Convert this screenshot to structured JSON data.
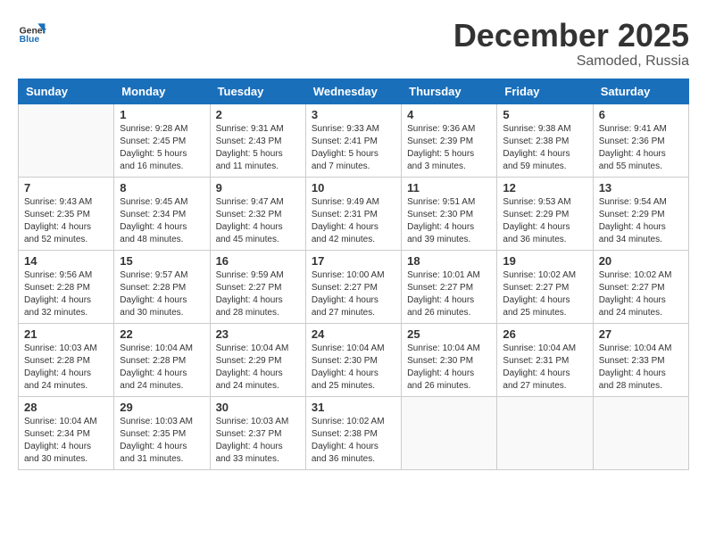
{
  "header": {
    "logo_line1": "General",
    "logo_line2": "Blue",
    "month": "December 2025",
    "location": "Samoded, Russia"
  },
  "weekdays": [
    "Sunday",
    "Monday",
    "Tuesday",
    "Wednesday",
    "Thursday",
    "Friday",
    "Saturday"
  ],
  "weeks": [
    [
      {
        "day": "",
        "info": ""
      },
      {
        "day": "1",
        "info": "Sunrise: 9:28 AM\nSunset: 2:45 PM\nDaylight: 5 hours\nand 16 minutes."
      },
      {
        "day": "2",
        "info": "Sunrise: 9:31 AM\nSunset: 2:43 PM\nDaylight: 5 hours\nand 11 minutes."
      },
      {
        "day": "3",
        "info": "Sunrise: 9:33 AM\nSunset: 2:41 PM\nDaylight: 5 hours\nand 7 minutes."
      },
      {
        "day": "4",
        "info": "Sunrise: 9:36 AM\nSunset: 2:39 PM\nDaylight: 5 hours\nand 3 minutes."
      },
      {
        "day": "5",
        "info": "Sunrise: 9:38 AM\nSunset: 2:38 PM\nDaylight: 4 hours\nand 59 minutes."
      },
      {
        "day": "6",
        "info": "Sunrise: 9:41 AM\nSunset: 2:36 PM\nDaylight: 4 hours\nand 55 minutes."
      }
    ],
    [
      {
        "day": "7",
        "info": "Sunrise: 9:43 AM\nSunset: 2:35 PM\nDaylight: 4 hours\nand 52 minutes."
      },
      {
        "day": "8",
        "info": "Sunrise: 9:45 AM\nSunset: 2:34 PM\nDaylight: 4 hours\nand 48 minutes."
      },
      {
        "day": "9",
        "info": "Sunrise: 9:47 AM\nSunset: 2:32 PM\nDaylight: 4 hours\nand 45 minutes."
      },
      {
        "day": "10",
        "info": "Sunrise: 9:49 AM\nSunset: 2:31 PM\nDaylight: 4 hours\nand 42 minutes."
      },
      {
        "day": "11",
        "info": "Sunrise: 9:51 AM\nSunset: 2:30 PM\nDaylight: 4 hours\nand 39 minutes."
      },
      {
        "day": "12",
        "info": "Sunrise: 9:53 AM\nSunset: 2:29 PM\nDaylight: 4 hours\nand 36 minutes."
      },
      {
        "day": "13",
        "info": "Sunrise: 9:54 AM\nSunset: 2:29 PM\nDaylight: 4 hours\nand 34 minutes."
      }
    ],
    [
      {
        "day": "14",
        "info": "Sunrise: 9:56 AM\nSunset: 2:28 PM\nDaylight: 4 hours\nand 32 minutes."
      },
      {
        "day": "15",
        "info": "Sunrise: 9:57 AM\nSunset: 2:28 PM\nDaylight: 4 hours\nand 30 minutes."
      },
      {
        "day": "16",
        "info": "Sunrise: 9:59 AM\nSunset: 2:27 PM\nDaylight: 4 hours\nand 28 minutes."
      },
      {
        "day": "17",
        "info": "Sunrise: 10:00 AM\nSunset: 2:27 PM\nDaylight: 4 hours\nand 27 minutes."
      },
      {
        "day": "18",
        "info": "Sunrise: 10:01 AM\nSunset: 2:27 PM\nDaylight: 4 hours\nand 26 minutes."
      },
      {
        "day": "19",
        "info": "Sunrise: 10:02 AM\nSunset: 2:27 PM\nDaylight: 4 hours\nand 25 minutes."
      },
      {
        "day": "20",
        "info": "Sunrise: 10:02 AM\nSunset: 2:27 PM\nDaylight: 4 hours\nand 24 minutes."
      }
    ],
    [
      {
        "day": "21",
        "info": "Sunrise: 10:03 AM\nSunset: 2:28 PM\nDaylight: 4 hours\nand 24 minutes."
      },
      {
        "day": "22",
        "info": "Sunrise: 10:04 AM\nSunset: 2:28 PM\nDaylight: 4 hours\nand 24 minutes."
      },
      {
        "day": "23",
        "info": "Sunrise: 10:04 AM\nSunset: 2:29 PM\nDaylight: 4 hours\nand 24 minutes."
      },
      {
        "day": "24",
        "info": "Sunrise: 10:04 AM\nSunset: 2:30 PM\nDaylight: 4 hours\nand 25 minutes."
      },
      {
        "day": "25",
        "info": "Sunrise: 10:04 AM\nSunset: 2:30 PM\nDaylight: 4 hours\nand 26 minutes."
      },
      {
        "day": "26",
        "info": "Sunrise: 10:04 AM\nSunset: 2:31 PM\nDaylight: 4 hours\nand 27 minutes."
      },
      {
        "day": "27",
        "info": "Sunrise: 10:04 AM\nSunset: 2:33 PM\nDaylight: 4 hours\nand 28 minutes."
      }
    ],
    [
      {
        "day": "28",
        "info": "Sunrise: 10:04 AM\nSunset: 2:34 PM\nDaylight: 4 hours\nand 30 minutes."
      },
      {
        "day": "29",
        "info": "Sunrise: 10:03 AM\nSunset: 2:35 PM\nDaylight: 4 hours\nand 31 minutes."
      },
      {
        "day": "30",
        "info": "Sunrise: 10:03 AM\nSunset: 2:37 PM\nDaylight: 4 hours\nand 33 minutes."
      },
      {
        "day": "31",
        "info": "Sunrise: 10:02 AM\nSunset: 2:38 PM\nDaylight: 4 hours\nand 36 minutes."
      },
      {
        "day": "",
        "info": ""
      },
      {
        "day": "",
        "info": ""
      },
      {
        "day": "",
        "info": ""
      }
    ]
  ]
}
